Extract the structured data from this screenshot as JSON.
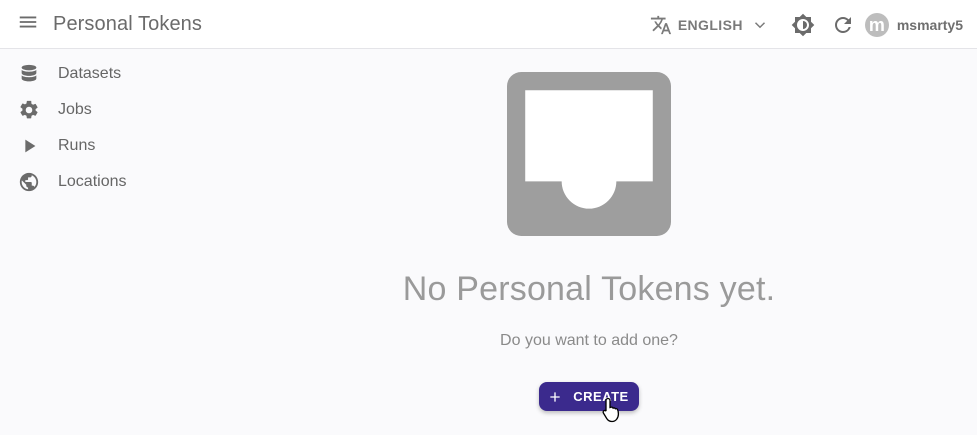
{
  "header": {
    "title": "Personal Tokens",
    "language": "ENGLISH",
    "username": "msmarty5",
    "avatar_letter": "m",
    "icons": {
      "menu": "menu-icon",
      "translate": "translate-icon",
      "chevron": "chevron-down-icon",
      "theme": "theme-toggle-icon",
      "refresh": "refresh-icon"
    }
  },
  "sidebar": {
    "items": [
      {
        "label": "Datasets",
        "icon": "database-icon"
      },
      {
        "label": "Jobs",
        "icon": "gear-icon"
      },
      {
        "label": "Runs",
        "icon": "play-icon"
      },
      {
        "label": "Locations",
        "icon": "globe-icon"
      }
    ]
  },
  "empty_state": {
    "icon": "inbox-icon",
    "title": "No Personal Tokens yet.",
    "subtitle": "Do you want to add one?",
    "create_label": "CREATE"
  },
  "colors": {
    "primary": "#3b2a8d",
    "icon_gray": "#7a7a7a",
    "empty_icon": "#9e9e9e",
    "background": "#fafafc"
  }
}
